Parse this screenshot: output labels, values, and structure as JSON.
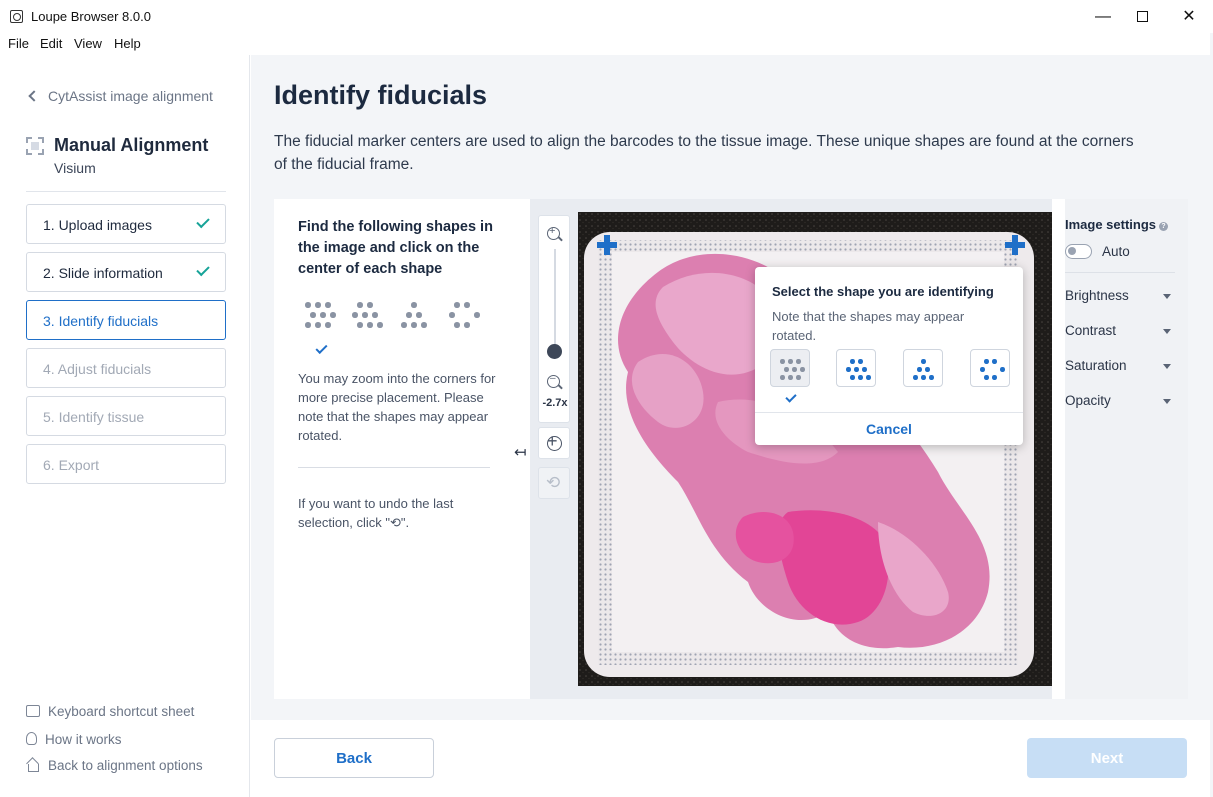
{
  "window": {
    "title": "Loupe Browser 8.0.0",
    "minimize": "—",
    "close": "✕"
  },
  "menu": [
    "File",
    "Edit",
    "View",
    "Help"
  ],
  "sidebar": {
    "back_label": "CytAssist image alignment",
    "mode_title": "Manual Alignment",
    "mode_subtitle": "Visium",
    "steps": [
      {
        "label": "1. Upload images",
        "state": "done"
      },
      {
        "label": "2. Slide information",
        "state": "done"
      },
      {
        "label": "3. Identify fiducials",
        "state": "active"
      },
      {
        "label": "4. Adjust fiducials",
        "state": "disabled"
      },
      {
        "label": "5. Identify tissue",
        "state": "disabled"
      },
      {
        "label": "6. Export",
        "state": "disabled"
      }
    ],
    "footer_links": [
      {
        "label": "Keyboard shortcut sheet",
        "icon": "keyboard-icon"
      },
      {
        "label": "How it works",
        "icon": "lightbulb-icon"
      },
      {
        "label": "Back to alignment options",
        "icon": "home-icon"
      }
    ]
  },
  "main": {
    "title": "Identify fiducials",
    "description": "The fiducial marker centers are used to align the barcodes to the tissue image. These unique shapes are found at the corners of the fiducial frame."
  },
  "instructions": {
    "heading": "Find the following shapes in the image and click on the center of each shape",
    "zoom_note": "You may zoom into the corners for more precise placement. Please note that the shapes may appear rotated.",
    "undo_note": "If you want to undo the last selection, click \"⟲\"."
  },
  "viewer": {
    "zoom_level": "-2.7x"
  },
  "popup": {
    "heading": "Select the shape you are identifying",
    "note": "Note that the shapes may appear rotated.",
    "cancel_label": "Cancel",
    "selected_shape": 0
  },
  "settings": {
    "heading": "Image settings",
    "auto_label": "Auto",
    "auto_on": false,
    "items": [
      "Brightness",
      "Contrast",
      "Saturation",
      "Opacity"
    ]
  },
  "footer": {
    "back_label": "Back",
    "next_label": "Next"
  },
  "colors": {
    "accent": "#1f6fc8",
    "check": "#17a398",
    "tissue": "#d9559a",
    "next_disabled": "#c7def5"
  }
}
